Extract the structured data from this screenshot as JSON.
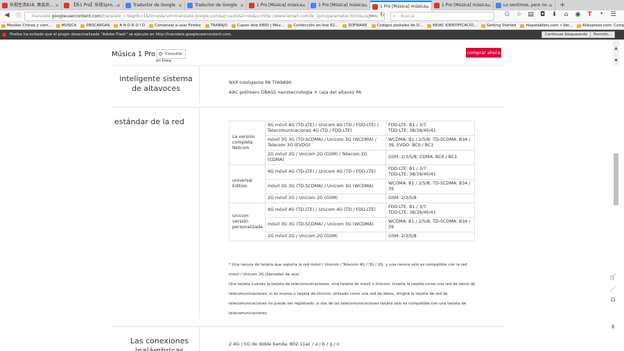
{
  "browser": {
    "tabs": [
      {
        "title": "乐视生活818, 奥会员...",
        "color": "#d33"
      },
      {
        "title": "【乐1 Pro】乐视1pro, ...",
        "color": "#d33"
      },
      {
        "title": "Traductor de Google",
        "color": "#4285f4"
      },
      {
        "title": "Traductor de Google",
        "color": "#4285f4"
      },
      {
        "title": "1 Pro [Música] música...",
        "color": "#d33"
      },
      {
        "title": "1 Pro [Música] música...",
        "color": "#4285f4"
      },
      {
        "title": "1 Pro [Música] música...",
        "color": "#d33"
      },
      {
        "title": "1 Pro [Música] música...",
        "color": "#d33"
      },
      {
        "title": "Lo sentimos, pero no ...",
        "color": "#4285f4"
      }
    ],
    "url_prefix": "translate.",
    "url_host": "googleusercontent.com",
    "url_rest": "/translate_c?depth=1&hl=es&rurl=translate.google.com&sl=auto&tl=es&u=http://www.lemall.com/le_1pro/parameter.html&usg=AL",
    "search_placeholder": "Buscar",
    "bookmarks": [
      "Moviles Chinos y com...",
      "MUSICA",
      "DESCARGAS",
      "A N D R O I D",
      "Comenzar a usar Firefox",
      "TRABAJO",
      "Cupon lete X800 | Móv...",
      "Confección on-line 62...",
      "SOFWARE",
      "Códigos postales de D...",
      "REIAC IDENTIFICACIÓ...",
      "Getting Started",
      "hispatablets.com • Ver...",
      "Aliexpress.com: Comp..."
    ],
    "flash_message": "Firefox ha evitado que el plugin desactualizado \"Adobe Flash\" se ejecute en http://translate.googleusercontent.com.",
    "flash_continue": "Continuar bloqueando",
    "flash_allow": "Permitir..."
  },
  "product": {
    "title": "Música 1 Pro",
    "consult_label": "Consulta",
    "online_label": "en línea",
    "buy_label": "comprar ahora"
  },
  "speaker": {
    "heading": "inteligente sistema de altavoces",
    "line1": "NXP inteligente PA TFA9890",
    "line2": "AAC polímero DBASS nanotecnología + caja del altavoz PA"
  },
  "network": {
    "heading": "estándar de la red",
    "groups": [
      {
        "name": "La versión completa Netcom",
        "rows": [
          {
            "band": "4G móvil 4G (TD-LTE) / Unicom 4G (TD / FDD-LTE) / Telecomunicaciones 4G (TD / FDD-LTE)",
            "freq": "FDD-LTE: B1 / 3/7\nTDD-LTE: 38/39/40/41"
          },
          {
            "band": "móvil 3G 3G (TD-SCDMA) / Unicom 3G (WCDMA) / Telecom 3G (EVDO)",
            "freq": "WCDMA: B1 / 2/5/8; TD-SCDMA: B34 / 39, EVDO: BC0 / BC1"
          },
          {
            "band": "2G móvil 2G / Unicom 2G (GSM) / Telecom 2G (CDMA)",
            "freq": "GSM: 2/3/5/8; CDMA: BC0 / BC1"
          }
        ]
      },
      {
        "name": "universal Edition",
        "rows": [
          {
            "band": "4G móvil 4G (TD-LTE) / Unicom 4G (TD / FDD-LTE)",
            "freq": "FDD-LTE: B1 / 3/7\nTDD-LTE: 38/39/40/41"
          },
          {
            "band": "móvil 3G 3G (TD-SCDMA) / Unicom 3G (WCDMA)",
            "freq": "WCDMA: B1 / 2/5/8; TD-SCDMA: B34 / 39"
          },
          {
            "band": "2G móvil 2G / Unicom 2G (GSM)",
            "freq": "GSM: 2/3/5/8"
          }
        ]
      },
      {
        "name": "Unicom versión personalizada",
        "rows": [
          {
            "band": "4G móvil 4G (TD-LTE) / Unicom 4G (TD / FDD-LTE)",
            "freq": "FDD-LTE: B1 / 3/7\nTDD-LTE: 38/39/40/41"
          },
          {
            "band": "móvil 3G 3G (TD-SCDMA) / Unicom 3G (WCDMA)",
            "freq": "WCDMA: B1 / 2/5/8; TD-SCDMA: B34 / 39"
          },
          {
            "band": "2G móvil 2G / Unicom 2G (GSM)",
            "freq": "GSM: 2/3/5/8"
          }
        ]
      }
    ],
    "note1": "* Una ranura de tarjeta que soporta la red móvil / Unicom / Telecom 4G / 3G / 2G, y una ranura sólo es compatible con la red móvil / Unicom 2G (llamadas de voz)",
    "note2": "Una tarjeta cuando la tarjeta de telecomunicaciones, otra tarjeta de móvil o Unicom, inserte la tarjeta como una red de datos de telecomunicaciones; si se mueve o tarjeta de Unicom utilizado como una red de datos, dirigirá la tarjeta de red de telecomunicaciones no puede ser registrado; si dos de las telecomunicaciones tarjeta sólo es compatible con una tarjeta de telecomunicaciones."
  },
  "connections": {
    "heading": "Las conexiones inalámbricas",
    "wifi": "2.4G / 5G de doble banda, 802.11ac / a / b / g / n"
  }
}
